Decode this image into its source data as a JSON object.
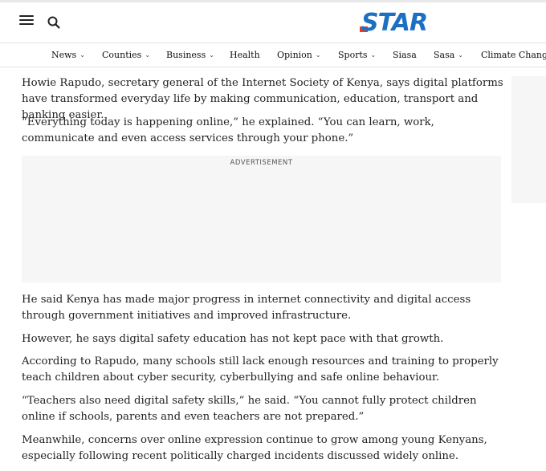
{
  "header": {
    "logo_text": "STAR",
    "menu_icon": "hamburger-icon",
    "search_icon": "search-icon"
  },
  "nav": {
    "items": [
      {
        "label": "News",
        "has_dropdown": true
      },
      {
        "label": "Counties",
        "has_dropdown": true
      },
      {
        "label": "Business",
        "has_dropdown": true
      },
      {
        "label": "Health",
        "has_dropdown": false
      },
      {
        "label": "Opinion",
        "has_dropdown": true
      },
      {
        "label": "Sports",
        "has_dropdown": true
      },
      {
        "label": "Siasa",
        "has_dropdown": false
      },
      {
        "label": "Sasa",
        "has_dropdown": true
      },
      {
        "label": "Climate Change",
        "has_dropdown": false
      }
    ]
  },
  "article": {
    "paragraphs": [
      "Howie Rapudo, secretary general of the Internet Society of Kenya, says digital platforms have transformed everyday life by making communication, education, transport and banking easier.",
      "“Everything today is happening online,” he explained. “You can learn, work, communicate and even access services through your phone.”",
      "He said Kenya has made major progress in internet connectivity and digital access through government initiatives and improved infrastructure.",
      "However, he says digital safety education has not kept pace with that growth.",
      "According to Rapudo, many schools still lack enough resources and training to properly teach children about cyber security, cyberbullying and safe online behaviour.",
      "“Teachers also need digital safety skills,” he said. “You cannot fully protect children online if schools, parents and even teachers are not prepared.”",
      "Meanwhile, concerns over online expression continue to grow among young Kenyans, especially following recent politically charged incidents discussed widely online."
    ],
    "ad_label": "ADVERTISEMENT"
  },
  "colors": {
    "logo_blue": "#1d6fc4",
    "logo_red": "#e23b2c",
    "ad_background": "#f6f6f6"
  }
}
